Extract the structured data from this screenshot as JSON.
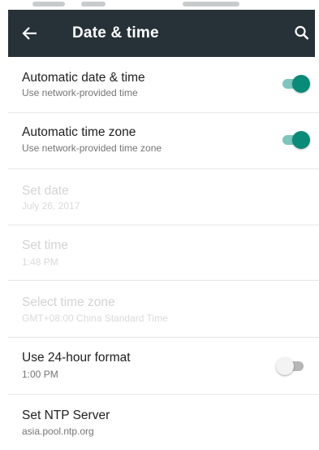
{
  "header": {
    "title": "Date & time",
    "back_icon": "arrow-back-icon",
    "search_icon": "search-icon",
    "background": "#263238"
  },
  "settings": [
    {
      "title": "Automatic date & time",
      "summary": "Use network-provided time",
      "enabled": true,
      "toggle": "on"
    },
    {
      "title": "Automatic time zone",
      "summary": "Use network-provided time zone",
      "enabled": true,
      "toggle": "on"
    },
    {
      "title": "Set date",
      "summary": "July 26, 2017",
      "enabled": false
    },
    {
      "title": "Set time",
      "summary": "1:48 PM",
      "enabled": false
    },
    {
      "title": "Select time zone",
      "summary": "GMT+08:00 China Standard Time",
      "enabled": false
    },
    {
      "title": "Use 24-hour format",
      "summary": "1:00 PM",
      "enabled": true,
      "toggle": "off"
    },
    {
      "title": "Set NTP Server",
      "summary": "asia.pool.ntp.org",
      "enabled": true
    }
  ],
  "colors": {
    "accent": "#0a8a78",
    "accent_track": "#7ec6bd",
    "text_primary": "#212121",
    "text_secondary": "#757575",
    "text_disabled": "#d3d3d3"
  }
}
